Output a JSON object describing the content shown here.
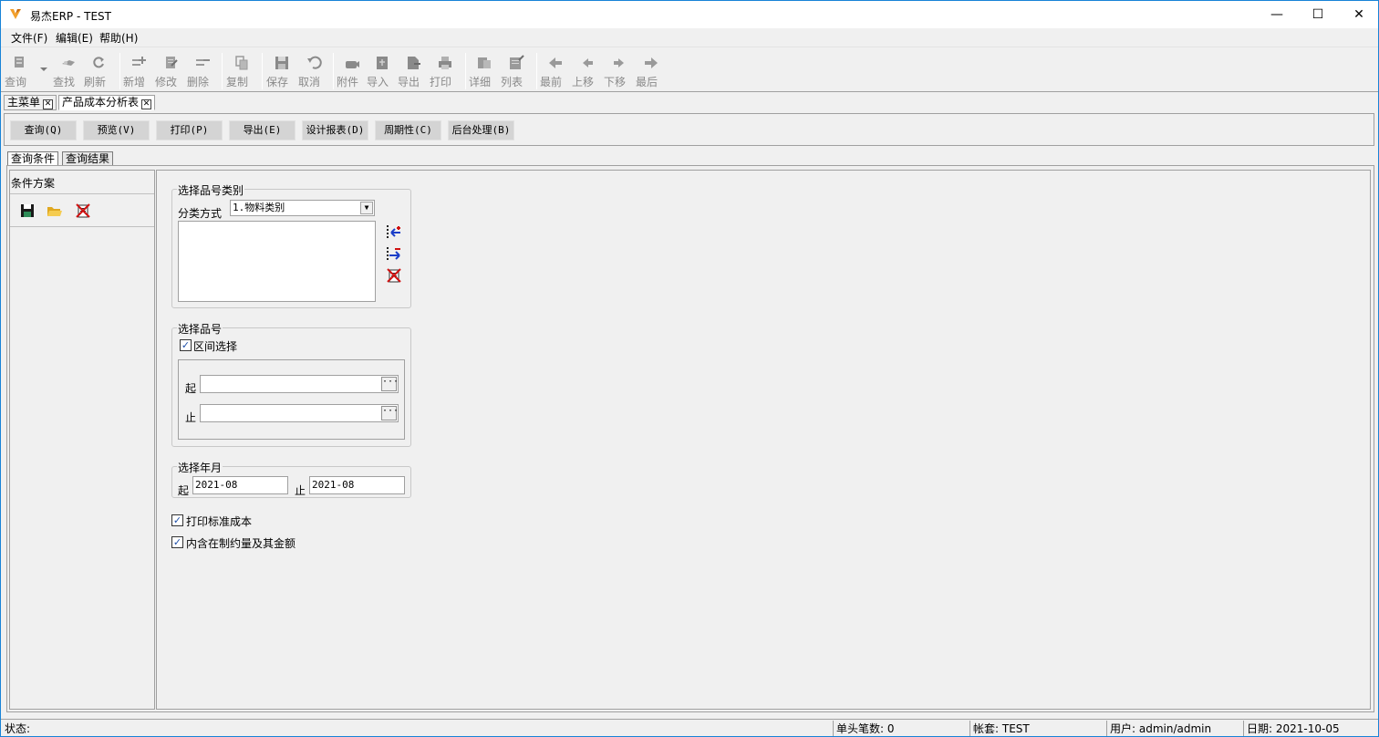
{
  "window": {
    "title": "易杰ERP - TEST",
    "min": "—",
    "max": "☐",
    "close": "✕"
  },
  "menu": [
    {
      "label": "文件(F)"
    },
    {
      "label": "编辑(E)"
    },
    {
      "label": "帮助(H)"
    }
  ],
  "toolbar": {
    "query": "查询",
    "find": "查找",
    "refresh": "刷新",
    "new": "新增",
    "edit": "修改",
    "delete": "删除",
    "copy": "复制",
    "save": "保存",
    "cancel": "取消",
    "attach": "附件",
    "import": "导入",
    "export": "导出",
    "print": "打印",
    "detail": "详细",
    "list": "列表",
    "first": "最前",
    "up": "上移",
    "down": "下移",
    "last": "最后"
  },
  "doc_tabs": [
    {
      "label": "主菜单"
    },
    {
      "label": "产品成本分析表"
    }
  ],
  "actions": {
    "query": "查询(Q)",
    "preview": "预览(V)",
    "print": "打印(P)",
    "export": "导出(E)",
    "design": "设计报表(D)",
    "period": "周期性(C)",
    "background": "后台处理(B)"
  },
  "query_tabs": {
    "conditions": "查询条件",
    "results": "查询结果"
  },
  "scheme": {
    "title": "条件方案"
  },
  "category_group": {
    "title": "选择品号类别",
    "method_label": "分类方式",
    "method_value": "1.物料类别",
    "arrow": "▼"
  },
  "item_group": {
    "title": "选择品号",
    "range_label": "区间选择",
    "range_checked": "✓",
    "from_label": "起",
    "to_label": "止",
    "ellipsis": "···"
  },
  "period_group": {
    "title": "选择年月",
    "from_label": "起",
    "from_value": "2021-08",
    "to_label": "止",
    "to_value": "2021-08"
  },
  "options": {
    "print_std": "打印标准成本",
    "print_std_checked": "✓",
    "include_wip": "内含在制约量及其金额",
    "include_wip_checked": "✓"
  },
  "status": {
    "state": "状态:",
    "count": "单头笔数: 0",
    "account": "帐套: TEST",
    "user": "用户: admin/admin",
    "date": "日期: 2021-10-05"
  }
}
